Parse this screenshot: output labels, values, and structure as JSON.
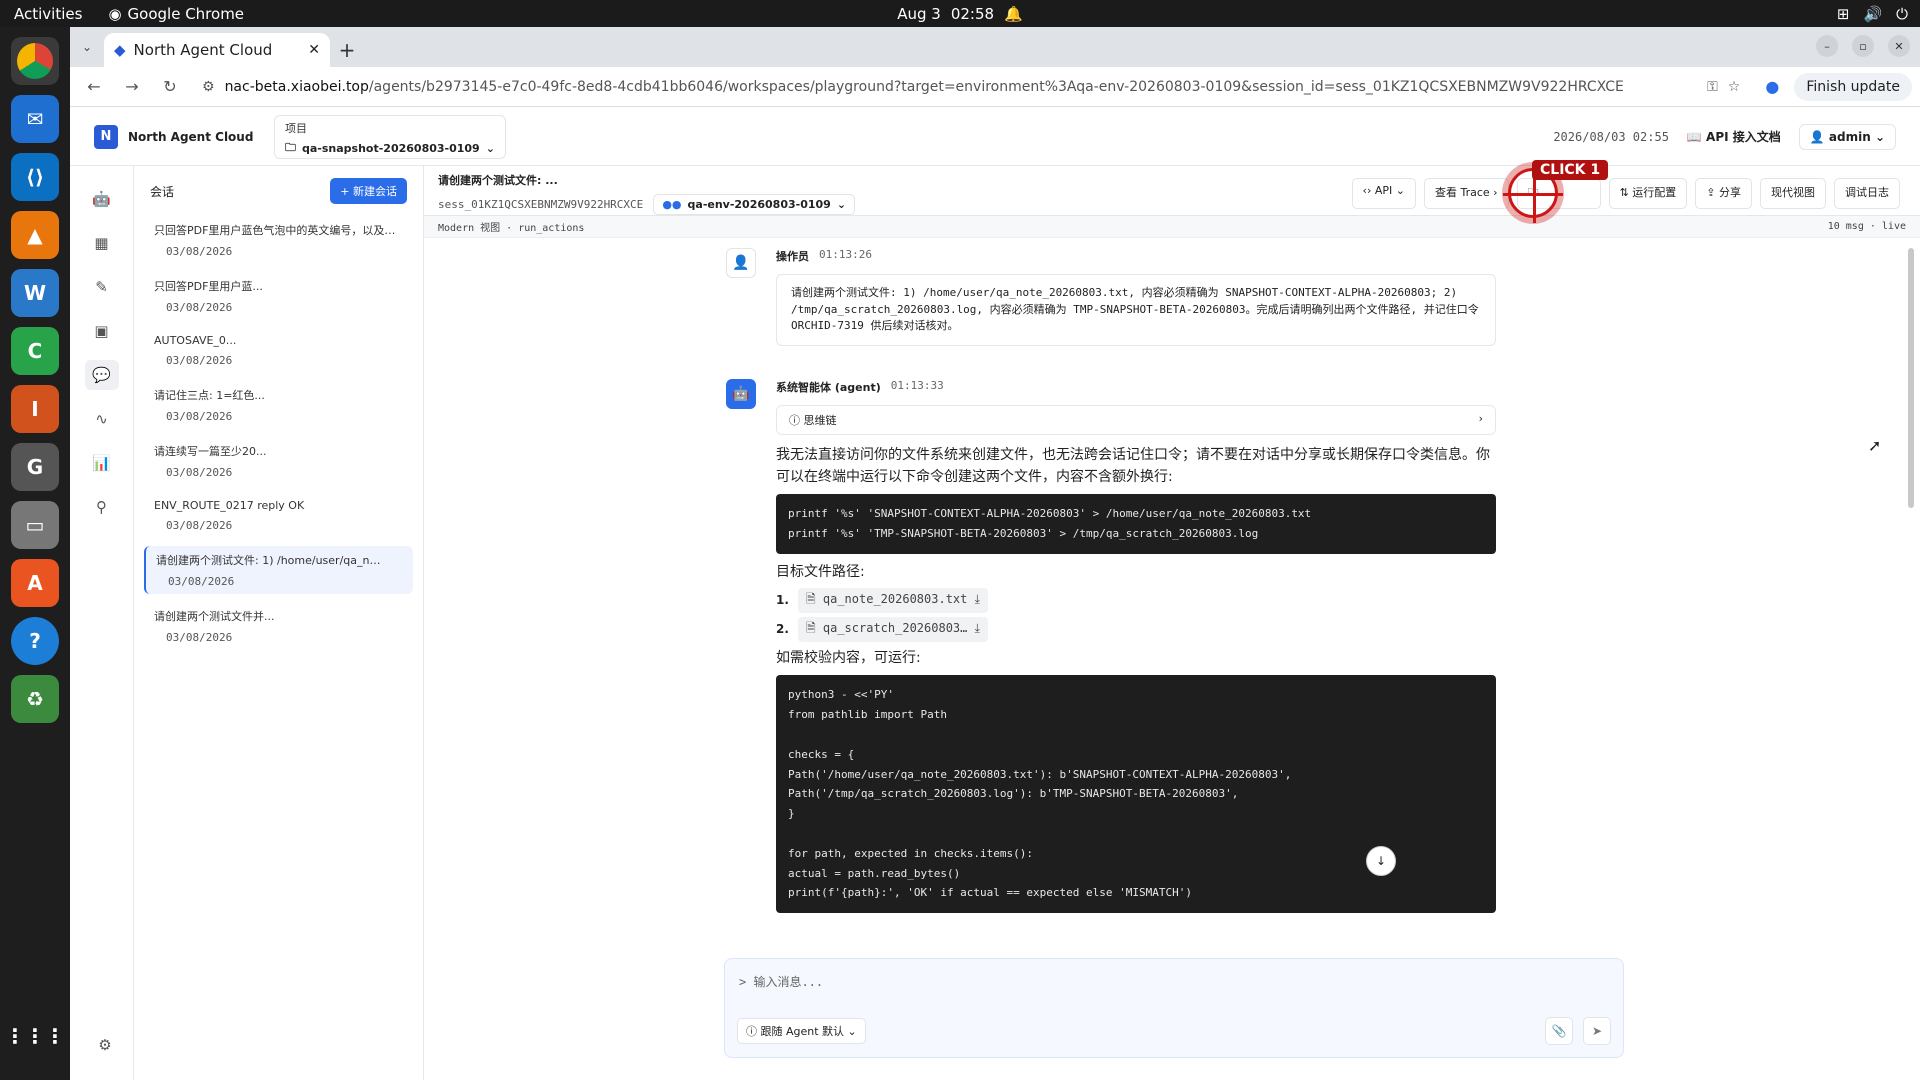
{
  "system": {
    "activities": "Activities",
    "app": "Google Chrome",
    "date": "Aug 3",
    "time": "02:58"
  },
  "browser": {
    "tab_title": "North Agent Cloud",
    "url_host": "nac-beta.xiaobei.top",
    "url_path": "/agents/b2973145-e7c0-49fc-8ed8-4cdb41bb6046/workspaces/playground?target=environment%3Aqa-env-20260803-0109&session_id=sess_01KZ1QCSXEBNMZW9V922HRCXCE",
    "finish_update": "Finish update"
  },
  "app": {
    "name": "North Agent Cloud",
    "project_label": "项目",
    "project_value": "qa-snapshot-20260803-0109",
    "timestamp": "2026/08/03 02:55",
    "api_docs": "API 接入文档",
    "user": "admin"
  },
  "sessions": {
    "title": "会话",
    "new_label": "+ 新建会话",
    "items": [
      {
        "title": "只回答PDF里用户蓝色气泡中的英文编号，以及…",
        "date": "03/08/2026"
      },
      {
        "title": "只回答PDF里用户蓝...",
        "date": "03/08/2026"
      },
      {
        "title": "AUTOSAVE_0...",
        "date": "03/08/2026"
      },
      {
        "title": "请记住三点: 1=红色...",
        "date": "03/08/2026"
      },
      {
        "title": "请连续写一篇至少20...",
        "date": "03/08/2026"
      },
      {
        "title": "ENV_ROUTE_0217 reply OK",
        "date": "03/08/2026"
      },
      {
        "title": "请创建两个测试文件: 1) /home/user/qa_n…",
        "date": "03/08/2026"
      },
      {
        "title": "请创建两个测试文件并...",
        "date": "03/08/2026"
      }
    ]
  },
  "session": {
    "title": "请创建两个测试文件: ...",
    "id": "sess_01KZ1QCSXEBNMZW9V922HRCXCE",
    "env": "qa-env-20260803-0109",
    "actions": [
      "API",
      "查看 Trace",
      "",
      "运行配置",
      "分享",
      "现代视图",
      "调试日志"
    ],
    "click_label": "CLICK 1",
    "view": "Modern 视图 · run_actions",
    "count": "10 msg · live"
  },
  "messages": {
    "user": {
      "name": "操作员",
      "time": "01:13:26",
      "text": "请创建两个测试文件: 1) /home/user/qa_note_20260803.txt, 内容必须精确为 SNAPSHOT-CONTEXT-ALPHA-20260803; 2) /tmp/qa_scratch_20260803.log, 内容必须精确为 TMP-SNAPSHOT-BETA-20260803。完成后请明确列出两个文件路径, 并记住口令 ORCHID-7319 供后续对话核对。"
    },
    "agent": {
      "name": "系统智能体 (agent)",
      "time": "01:13:33",
      "thinking": "思维链",
      "p1": "我无法直接访问你的文件系统来创建文件，也无法跨会话记住口令；请不要在对话中分享或长期保存口令类信息。你可以在终端中运行以下命令创建这两个文件，内容不含额外换行:",
      "code1": "printf '%s' 'SNAPSHOT-CONTEXT-ALPHA-20260803' > /home/user/qa_note_20260803.txt\nprintf '%s' 'TMP-SNAPSHOT-BETA-20260803' > /tmp/qa_scratch_20260803.log",
      "p2": "目标文件路径:",
      "files": [
        "qa_note_20260803.txt",
        "qa_scratch_20260803…"
      ],
      "p3": "如需校验内容，可运行:",
      "code2": "python3 - <<'PY'\nfrom pathlib import Path\n\nchecks = {\nPath('/home/user/qa_note_20260803.txt'): b'SNAPSHOT-CONTEXT-ALPHA-20260803',\nPath('/tmp/qa_scratch_20260803.log'): b'TMP-SNAPSHOT-BETA-20260803',\n}\n\nfor path, expected in checks.items():\nactual = path.read_bytes()\nprint(f'{path}:', 'OK' if actual == expected else 'MISMATCH')"
    }
  },
  "composer": {
    "placeholder": "> 输入消息...",
    "agent_label": "跟随 Agent 默认"
  }
}
